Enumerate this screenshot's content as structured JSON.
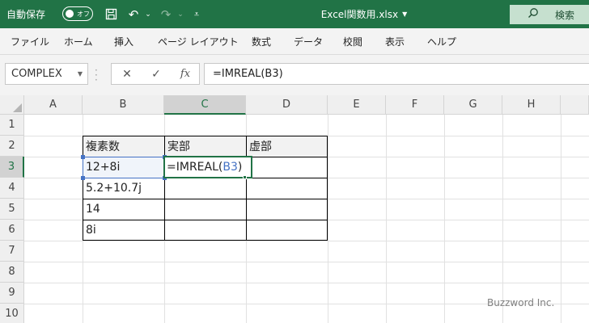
{
  "titlebar": {
    "autosave_label": "自動保存",
    "autosave_state": "オフ",
    "filename": "Excel関数用.xlsx",
    "search_label": "検索",
    "icons": [
      "save-icon",
      "undo-icon",
      "redo-icon",
      "customize-qat-icon",
      "search-icon"
    ]
  },
  "ribbon_tabs": [
    "ファイル",
    "ホーム",
    "挿入",
    "ページ レイアウト",
    "数式",
    "データ",
    "校閲",
    "表示",
    "ヘルプ"
  ],
  "formula_bar": {
    "name_box": "COMPLEX",
    "formula": "=IMREAL(B3)"
  },
  "columns": [
    "A",
    "B",
    "C",
    "D",
    "E",
    "F",
    "G",
    "H"
  ],
  "rows": [
    "1",
    "2",
    "3",
    "4",
    "5",
    "6",
    "7",
    "8",
    "9",
    "10"
  ],
  "active_column": "C",
  "active_row": "3",
  "table": {
    "headers": [
      "複素数",
      "実部",
      "虚部"
    ],
    "values": [
      "12+8i",
      "5.2+10.7j",
      "14",
      "8i"
    ]
  },
  "editing_cell": {
    "prefix": "=IMREAL(",
    "ref": "B3",
    "suffix": ")"
  },
  "watermark": "Buzzword Inc.",
  "colors": {
    "excel_green": "#217346",
    "reference_blue": "#4472c4"
  }
}
